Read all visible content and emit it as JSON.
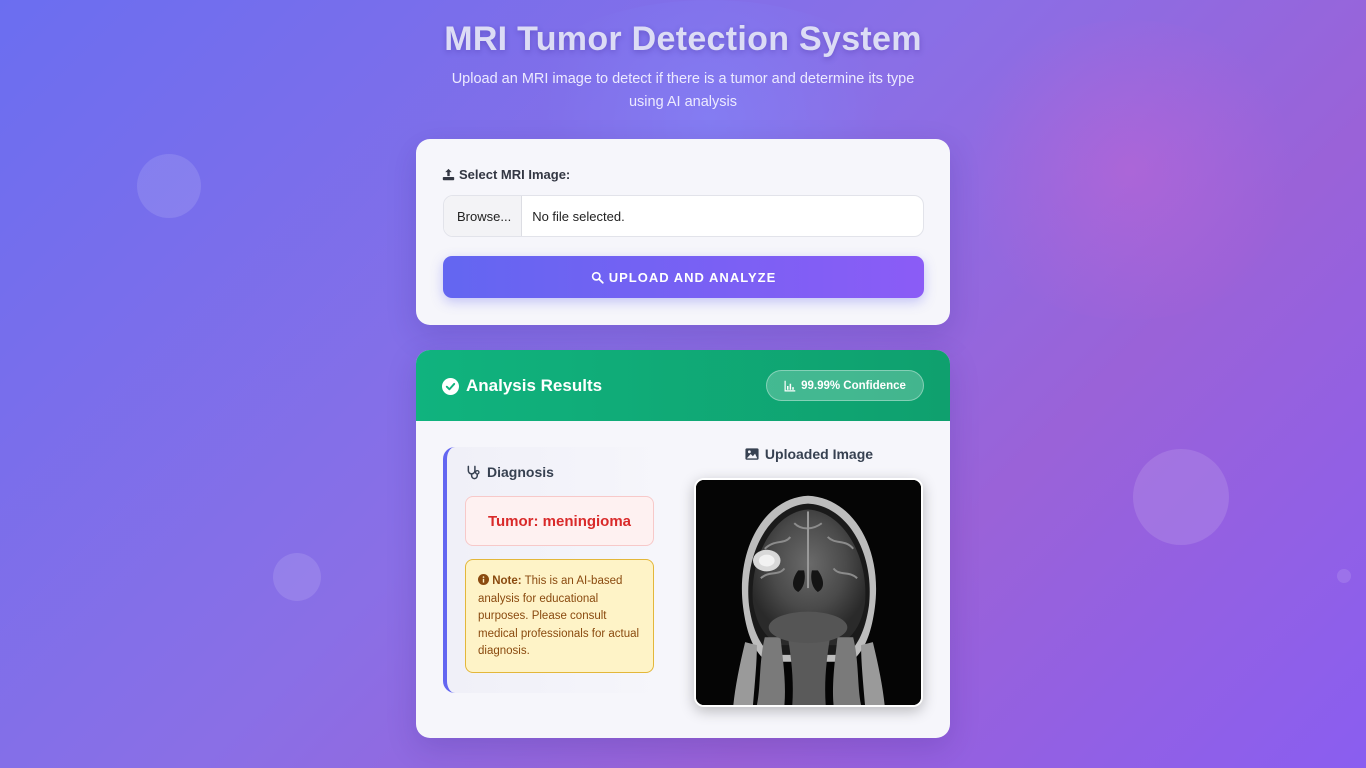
{
  "header": {
    "title": "MRI Tumor Detection System",
    "subtitle": "Upload an MRI image to detect if there is a tumor and determine its type using AI analysis"
  },
  "upload": {
    "label": "Select MRI Image:",
    "label_icon": "upload-icon",
    "browse_label": "Browse...",
    "file_status": "No file selected.",
    "button_label": "UPLOAD AND ANALYZE",
    "button_icon": "search-icon"
  },
  "results": {
    "title": "Analysis Results",
    "title_icon": "check-circle-icon",
    "confidence": "99.99% Confidence",
    "confidence_icon": "bar-chart-icon",
    "diagnosis_title": "Diagnosis",
    "diagnosis_icon": "stethoscope-icon",
    "tumor_result": "Tumor: meningioma",
    "note_label": "Note:",
    "note_text": "This is an AI-based analysis for educational purposes. Please consult medical professionals for actual diagnosis.",
    "note_icon": "info-icon",
    "image_title": "Uploaded Image",
    "image_icon": "image-icon"
  },
  "colors": {
    "accent": "#6366f1",
    "accent_end": "#8b5cf6",
    "success": "#10b37e",
    "danger": "#d92a2a",
    "warning_bg": "#fef3c7"
  }
}
